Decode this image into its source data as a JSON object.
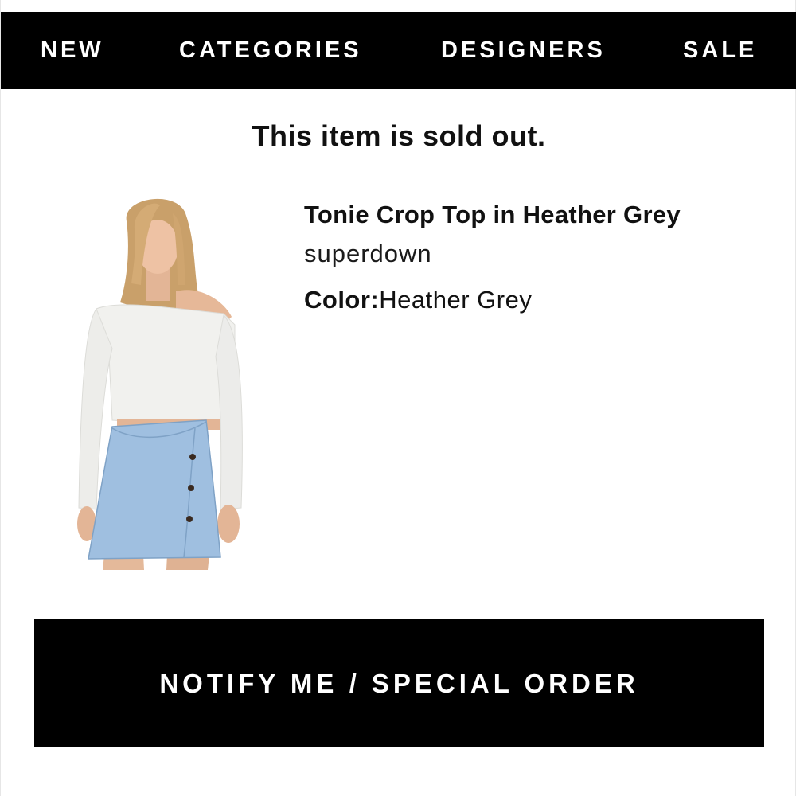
{
  "nav": {
    "items": [
      {
        "label": "NEW"
      },
      {
        "label": "CATEGORIES"
      },
      {
        "label": "DESIGNERS"
      },
      {
        "label": "SALE"
      }
    ]
  },
  "notice": {
    "text": "This item is sold out."
  },
  "product": {
    "name": "Tonie Crop Top in Heather Grey",
    "brand": "superdown",
    "color_label": "Color:",
    "color_value": "Heather Grey",
    "image_icon": "product-photo"
  },
  "cta": {
    "label": "NOTIFY ME / SPECIAL ORDER"
  },
  "colors": {
    "nav_background": "#000000",
    "nav_text": "#ffffff",
    "button_background": "#000000",
    "button_text": "#ffffff",
    "body_text": "#111111"
  }
}
